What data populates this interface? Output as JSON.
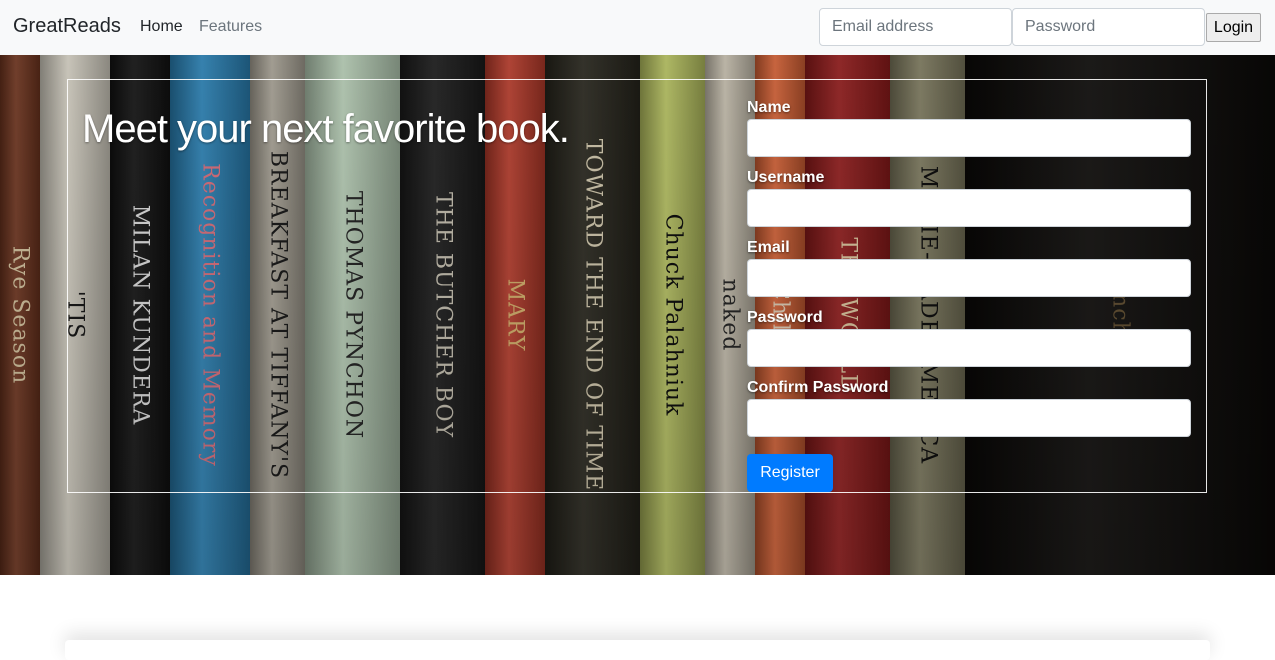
{
  "navbar": {
    "brand": "GreatReads",
    "links": [
      {
        "label": "Home"
      },
      {
        "label": "Features"
      }
    ],
    "login": {
      "email_placeholder": "Email address",
      "password_placeholder": "Password",
      "button_label": "Login"
    }
  },
  "hero": {
    "headline": "Meet your next favorite book.",
    "books": [
      {
        "color": "#7a3a22",
        "text": "Rye Season",
        "text_color": "#e8d6b0"
      },
      {
        "color": "#e9e4d6",
        "text": "'TIS",
        "text_color": "#1b1b1b"
      },
      {
        "color": "#141414",
        "text": "MILAN KUNDERA",
        "text_color": "#f2f2f2"
      },
      {
        "color": "#2f8fc8",
        "text": "Recognition and Memory",
        "text_color": "#f07e8c"
      },
      {
        "color": "#b8b2a4",
        "text": "BREAKFAST AT TIFFANY'S",
        "text_color": "#1f1f1f"
      },
      {
        "color": "#c9e2c8",
        "text": "THOMAS PYNCHON",
        "text_color": "#2b2b2b"
      },
      {
        "color": "#1e1e1e",
        "text": "THE BUTCHER BOY",
        "text_color": "#d8d2c2"
      },
      {
        "color": "#c9412f",
        "text": "MARY",
        "text_color": "#e8c27a"
      },
      {
        "color": "#2c2a20",
        "text": "TOWARD THE END OF TIME",
        "text_color": "#e6dcc0"
      },
      {
        "color": "#c8d46a",
        "text": "Chuck Palahniuk",
        "text_color": "#111111"
      },
      {
        "color": "#d8d0be",
        "text": "naked",
        "text_color": "#2a2a2a"
      },
      {
        "color": "#e86a3a",
        "text": "Child",
        "text_color": "#f3e0c8"
      },
      {
        "color": "#a01e1e",
        "text": "THE WORLD",
        "text_color": "#f0d9b0"
      },
      {
        "color": "#8a8668",
        "text": "MOVIE-MADE AMERICA",
        "text_color": "#111111"
      },
      {
        "color": "#0d0b09",
        "text": "Pynchon",
        "text_color": "#6e5a3a"
      }
    ]
  },
  "register_form": {
    "fields": [
      {
        "label": "Name"
      },
      {
        "label": "Username"
      },
      {
        "label": "Email"
      },
      {
        "label": "Password"
      },
      {
        "label": "Confirm Password"
      }
    ],
    "button_label": "Register"
  },
  "colors": {
    "primary": "#007bff",
    "navbar_bg": "#f8f9fa"
  }
}
